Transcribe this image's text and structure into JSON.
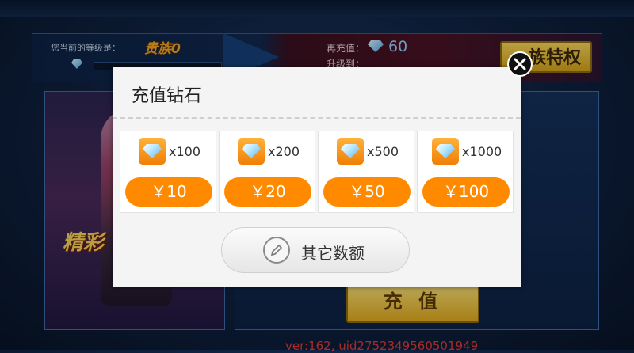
{
  "background": {
    "level_label": "您当前的等级是：",
    "level_badge": "贵族0",
    "recharge_label": "再充值：",
    "recharge_value": "60",
    "promote_label": "升级到：",
    "noble_privilege_button": "族特权",
    "promo_text": "精彩",
    "charge_button": "充 值",
    "version_text": "ver:162, uid2752349560501949"
  },
  "dialog": {
    "title": "充值钻石",
    "options": [
      {
        "qty": "x100",
        "price": "￥10"
      },
      {
        "qty": "x200",
        "price": "￥20"
      },
      {
        "qty": "x500",
        "price": "￥50"
      },
      {
        "qty": "x1000",
        "price": "￥100"
      }
    ],
    "other_amount_label": "其它数额"
  },
  "colors": {
    "accent": "#ff8a00",
    "dialog_bg": "#f4f4f4"
  }
}
